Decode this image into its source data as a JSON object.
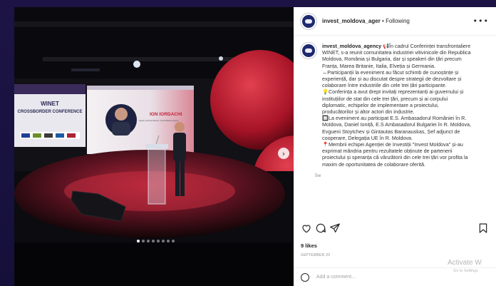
{
  "post": {
    "username": "invest_moldova_agency",
    "header_username": "invest_moldova_ager",
    "separator": " • ",
    "follow_status": "Following",
    "more_label": "•••",
    "caption_user": "invest_moldova_agency",
    "caption_lines": [
      "📢În cadrul Conferinței transfrontaliere",
      "WINET, s-a reunit comunitatea industriei vitivinicole din Republica",
      "Moldova, România și Bulgaria, dar și speakeri din țări precum",
      "Franța, Marea Britanie, Italia, Elveția și Germania.",
      "↔Participanții la eveniment au făcut schimb de cunoștințe și",
      "experiență, dar și au discutat despre strategii de dezvoltare și",
      "colaborare între industriile din cele trei țări participante.",
      "💡Conferința a avut drept invitați reprezentanți ai guvernului și",
      "instituțiilor de stat din cele trei țări, precum și ai corpului",
      "diplomatic, echipelor de implementare a proiectului,",
      "producătorilor și altor actori din industrie.",
      "🔲La eveniment au participat E.S. Ambasadorul României în R.",
      "Moldova, Daniel Ioniță, E.S Ambasadorul Bulgariei în R. Moldova,",
      "Evgueni Stoytchev și Gintautas Baranauskas, Șef adjunct de",
      "cooperare, Delegația UE în R. Moldova.",
      "📍Membrii echipei Agenției de Investiții \"Invest Moldova\" și-au",
      "exprimat mândria pentru rezultatele obținute de partenerii",
      "proiectului și speranța că vânzătorii din cele trei țări vor profita la",
      "maxim de oportunitatea de colaborare oferită."
    ],
    "time_ago": "5w",
    "likes": "9 likes",
    "date": "SEPTEMBER 20",
    "comment_placeholder": "Add a comment..."
  },
  "photo": {
    "screen_title_1": "WINET",
    "screen_title_2": "CROSSBORDER CONFERENCE",
    "speaker_name": "ION IORDACHI",
    "speaker_role": "Deputy General Director, Invest Moldova Agency",
    "next_arrow": "›",
    "carousel_count": 8,
    "carousel_active": 0
  },
  "watermark": {
    "title": "Activate W",
    "subtitle": "Go to Settings"
  },
  "icons": {
    "like": "heart-icon",
    "comment": "comment-icon",
    "share": "share-icon",
    "save": "bookmark-icon",
    "emoji": "emoji-icon"
  }
}
